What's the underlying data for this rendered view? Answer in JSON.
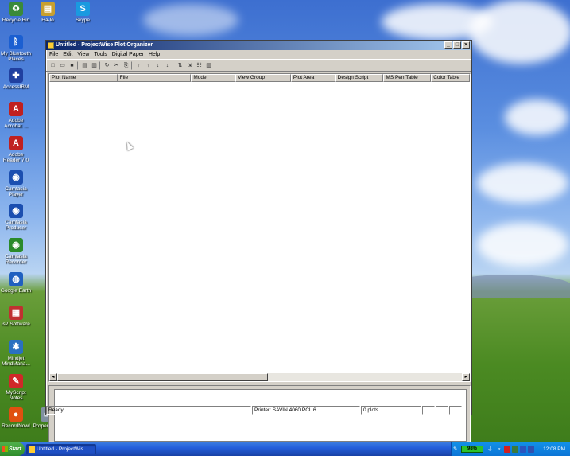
{
  "desktop": {
    "icons": [
      {
        "label": "Recycle Bin",
        "icon": "recycle-bin-icon",
        "color": "#3a8a3a",
        "glyph": "♻"
      },
      {
        "label": "Ha-lo",
        "icon": "folder-icon",
        "color": "#c8a030",
        "glyph": "▤"
      },
      {
        "label": "Skype",
        "icon": "skype-icon",
        "color": "#1a9ae0",
        "glyph": "S"
      },
      {
        "label": "My Bluetooth Places",
        "icon": "bluetooth-icon",
        "color": "#1b5fd1",
        "glyph": "ᛒ"
      },
      {
        "label": "AccessIBM",
        "icon": "access-ibm-icon",
        "color": "#2040a0",
        "glyph": "✚"
      },
      {
        "label": "Adobe Acrobat ...",
        "icon": "acrobat-icon",
        "color": "#c02020",
        "glyph": "A"
      },
      {
        "label": "Adobe Reader 7.0",
        "icon": "adobe-reader-icon",
        "color": "#c02020",
        "glyph": "A"
      },
      {
        "label": "Camtasia Player",
        "icon": "camtasia-player-icon",
        "color": "#1c4fb0",
        "glyph": "◉"
      },
      {
        "label": "Camtasia Producer",
        "icon": "camtasia-producer-icon",
        "color": "#1c4fb0",
        "glyph": "◉"
      },
      {
        "label": "Camtasia Recorder",
        "icon": "camtasia-recorder-icon",
        "color": "#2a8a2a",
        "glyph": "◉"
      },
      {
        "label": "Google Earth",
        "icon": "google-earth-icon",
        "color": "#2060c0",
        "glyph": "◍"
      },
      {
        "label": "is2 Software",
        "icon": "is2-software-icon",
        "color": "#c03030",
        "glyph": "▦"
      },
      {
        "label": "Mindjet MindMana...",
        "icon": "mindjet-icon",
        "color": "#2a70c0",
        "glyph": "✱"
      },
      {
        "label": "MyScript Notes",
        "icon": "myscript-icon",
        "color": "#d02828",
        "glyph": "✎"
      },
      {
        "label": "RecordNow!",
        "icon": "recordnow-icon",
        "color": "#e05010",
        "glyph": "●"
      },
      {
        "label": "PropertySy...",
        "icon": "property-icon",
        "color": "#8090a0",
        "glyph": "▭"
      }
    ]
  },
  "window": {
    "title": "Untitled - ProjectWise Plot Organizer",
    "controls": {
      "minimize": "_",
      "maximize": "□",
      "close": "×"
    },
    "menu": [
      "File",
      "Edit",
      "View",
      "Tools",
      "Digital Paper",
      "Help"
    ],
    "toolbar_glyphs": [
      "□",
      "▭",
      "■",
      "|",
      "▤",
      "▥",
      "|",
      "↻",
      "✂",
      "⎘",
      "|",
      "↑",
      "↑",
      "↓",
      "↓",
      "|",
      "⇅",
      "⇲",
      "☷",
      "▥"
    ],
    "columns": [
      "Plot Name",
      "File",
      "Model",
      "View Group",
      "Plot Area",
      "Design Script",
      "MS Pen Table",
      "Color Table"
    ],
    "status": {
      "left": "Ready",
      "printer": "Printer: SAVIN 4060 PCL 6",
      "count": "0 plots"
    }
  },
  "taskbar": {
    "start_label": "Start",
    "task_label": "Untitled - ProjectWis...",
    "battery": "98%",
    "clock": "12:08 PM"
  }
}
